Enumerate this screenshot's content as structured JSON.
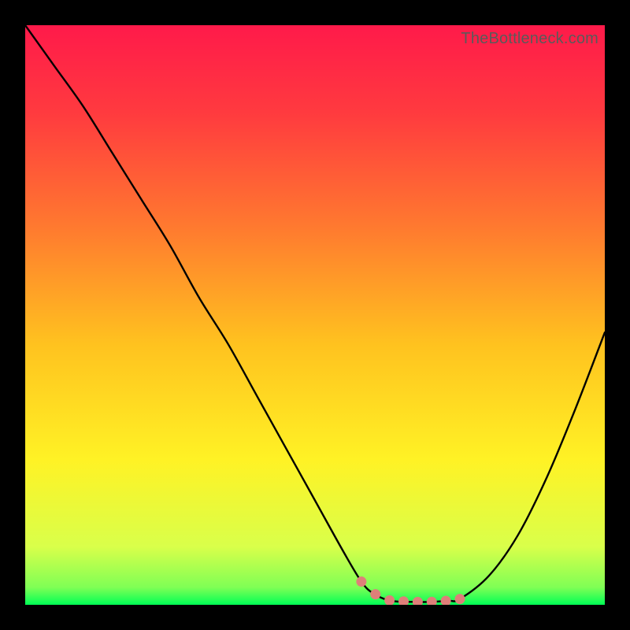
{
  "watermark": "TheBottleneck.com",
  "chart_data": {
    "type": "line",
    "title": "",
    "xlabel": "",
    "ylabel": "",
    "xlim": [
      0,
      100
    ],
    "ylim": [
      0,
      100
    ],
    "x": [
      0,
      5,
      10,
      15,
      20,
      25,
      30,
      35,
      40,
      45,
      50,
      55,
      58,
      60,
      63,
      67,
      70,
      73,
      75,
      80,
      85,
      90,
      95,
      100
    ],
    "y": [
      100,
      93,
      86,
      78,
      70,
      62,
      53,
      45,
      36,
      27,
      18,
      9,
      4,
      2,
      0.7,
      0.5,
      0.5,
      0.7,
      1,
      5,
      12,
      22,
      34,
      47
    ],
    "highlight_zone": {
      "x_from": 58,
      "x_to": 75,
      "color": "#de7f79"
    },
    "gradient_stops": [
      {
        "offset": 0.0,
        "color": "#ff1a4a"
      },
      {
        "offset": 0.15,
        "color": "#ff3a3f"
      },
      {
        "offset": 0.35,
        "color": "#ff7a2f"
      },
      {
        "offset": 0.55,
        "color": "#ffc21f"
      },
      {
        "offset": 0.75,
        "color": "#fff225"
      },
      {
        "offset": 0.9,
        "color": "#d9ff4a"
      },
      {
        "offset": 0.97,
        "color": "#7fff55"
      },
      {
        "offset": 1.0,
        "color": "#00ff55"
      }
    ]
  }
}
